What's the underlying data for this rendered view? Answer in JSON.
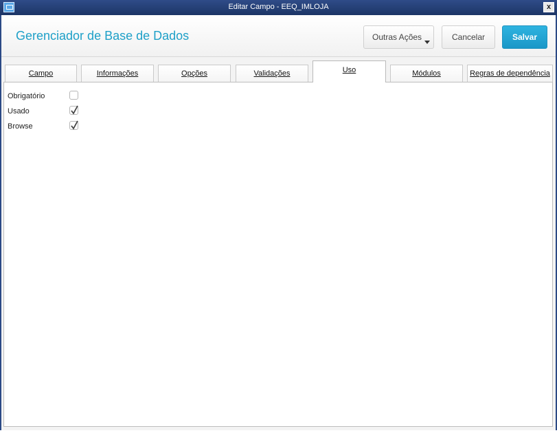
{
  "window": {
    "title": "Editar Campo - EEQ_IMLOJA",
    "close_label": "x"
  },
  "header": {
    "title": "Gerenciador de Base de Dados",
    "buttons": {
      "other_actions": "Outras Ações",
      "cancel": "Cancelar",
      "save": "Salvar"
    }
  },
  "tabs": [
    {
      "label": "Campo",
      "active": false
    },
    {
      "label": "Informações",
      "active": false
    },
    {
      "label": "Opções",
      "active": false
    },
    {
      "label": "Validações",
      "active": false
    },
    {
      "label": "Uso",
      "active": true
    },
    {
      "label": "Módulos",
      "active": false
    },
    {
      "label": "Regras de dependência",
      "active": false
    }
  ],
  "fields": [
    {
      "label": "Obrigatório",
      "checked": false
    },
    {
      "label": "Usado",
      "checked": true
    },
    {
      "label": "Browse",
      "checked": true
    }
  ],
  "colors": {
    "accent": "#1ea0c8",
    "titlebar": "#1c3566",
    "save_button": "#1a97c7"
  }
}
